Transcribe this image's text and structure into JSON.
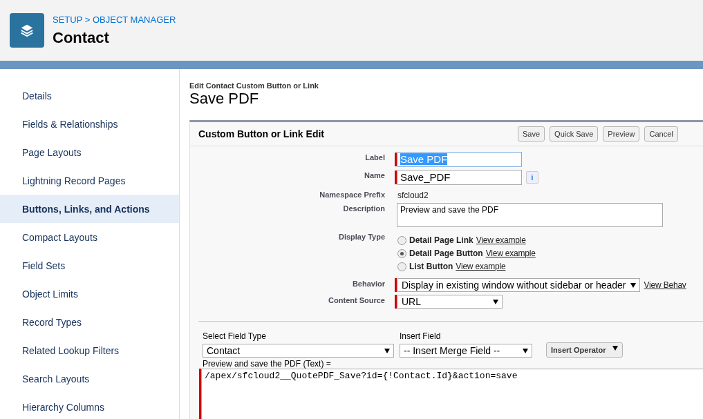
{
  "header": {
    "breadcrumb": "SETUP > OBJECT MANAGER",
    "title": "Contact"
  },
  "sidebar": {
    "items": [
      {
        "label": "Details",
        "selected": false
      },
      {
        "label": "Fields & Relationships",
        "selected": false
      },
      {
        "label": "Page Layouts",
        "selected": false
      },
      {
        "label": "Lightning Record Pages",
        "selected": false
      },
      {
        "label": "Buttons, Links, and Actions",
        "selected": true
      },
      {
        "label": "Compact Layouts",
        "selected": false
      },
      {
        "label": "Field Sets",
        "selected": false
      },
      {
        "label": "Object Limits",
        "selected": false
      },
      {
        "label": "Record Types",
        "selected": false
      },
      {
        "label": "Related Lookup Filters",
        "selected": false
      },
      {
        "label": "Search Layouts",
        "selected": false
      },
      {
        "label": "Hierarchy Columns",
        "selected": false
      }
    ]
  },
  "page": {
    "subtitle": "Edit Contact Custom Button or Link",
    "title": "Save PDF"
  },
  "panel": {
    "title": "Custom Button or Link Edit",
    "buttons": [
      "Save",
      "Quick Save",
      "Preview",
      "Cancel"
    ],
    "fields": [
      {
        "kind": "input",
        "label": "Label",
        "value": "Save PDF",
        "required": true,
        "highlighted": true
      },
      {
        "kind": "input",
        "label": "Name",
        "value": "Save_PDF",
        "required": true,
        "highlighted": false,
        "info": "i"
      },
      {
        "kind": "text",
        "label": "Namespace Prefix",
        "value": "sfcloud2"
      },
      {
        "kind": "textarea",
        "label": "Description",
        "value": "Preview and save the PDF"
      },
      {
        "kind": "radios",
        "label": "Display Type",
        "options": [
          {
            "label": "Detail Page Link",
            "link": "View example",
            "selected": false
          },
          {
            "label": "Detail Page Button",
            "link": "View example",
            "selected": true
          },
          {
            "label": "List Button",
            "link": "View example",
            "selected": false
          }
        ]
      },
      {
        "kind": "select",
        "label": "Behavior",
        "value": "Display in existing window without sidebar or header",
        "required": true,
        "link": "View Behav"
      },
      {
        "kind": "select",
        "label": "Content Source",
        "value": "URL",
        "required": true
      }
    ]
  },
  "formula": {
    "field_type_label": "Select Field Type",
    "field_type": "Contact",
    "insert_field_label": "Insert Field",
    "insert_field": "-- Insert Merge Field --",
    "operator_button": "Insert Operator",
    "editor_label": "Preview and save the PDF (Text) =",
    "code": "/apex/sfcloud2__QuotePDF_Save?id={!Contact.Id}&action=save"
  }
}
